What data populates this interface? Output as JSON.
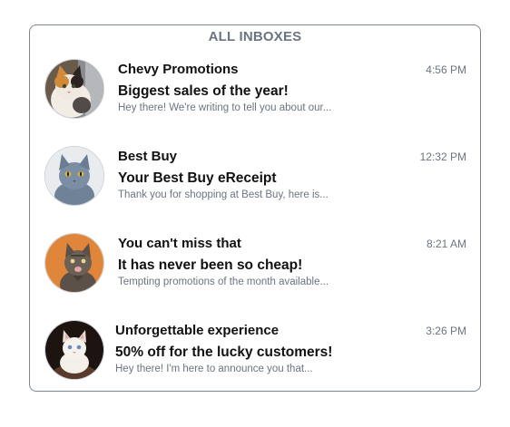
{
  "header": {
    "title": "ALL INBOXES"
  },
  "messages": [
    {
      "sender": "Chevy Promotions",
      "subject": "Biggest sales of the year!",
      "preview": "Hey there! We're writing to tell you about our...",
      "time": "4:56 PM",
      "avatar_icon": "calico-cat-avatar"
    },
    {
      "sender": "Best Buy",
      "subject": "Your Best Buy eReceipt",
      "preview": "Thank you for shopping at Best Buy, here is...",
      "time": "12:32 PM",
      "avatar_icon": "gray-cat-avatar"
    },
    {
      "sender": "You can't miss that",
      "subject": "It has never been so cheap!",
      "preview": "Tempting promotions of the month available...",
      "time": "8:21 AM",
      "avatar_icon": "tabby-cat-orange-bg-avatar"
    },
    {
      "sender": "Unforgettable experience",
      "subject": "50% off for the lucky customers!",
      "preview": "Hey there! I'm here to announce you that...",
      "time": "3:26 PM",
      "avatar_icon": "white-kitten-avatar"
    }
  ],
  "colors": {
    "border": "#7d8590",
    "muted_text": "#6b7481",
    "primary_text": "#111111"
  }
}
